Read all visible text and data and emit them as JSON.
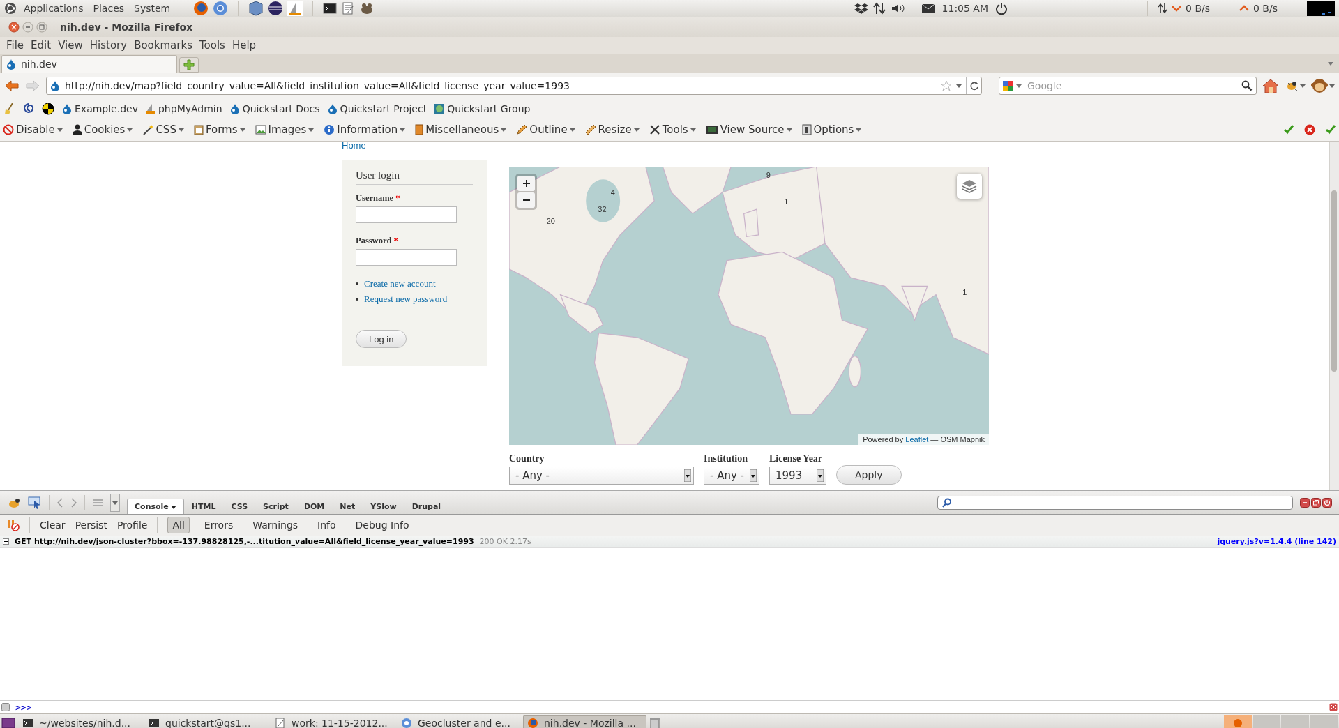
{
  "top_panel": {
    "menus": [
      "Applications",
      "Places",
      "System"
    ],
    "clock": "11:05 AM",
    "net_down": "0 B/s",
    "net_up": "0 B/s"
  },
  "window": {
    "title": "nih.dev - Mozilla Firefox"
  },
  "menu_bar": [
    "File",
    "Edit",
    "View",
    "History",
    "Bookmarks",
    "Tools",
    "Help"
  ],
  "tabs": [
    {
      "label": "nih.dev",
      "selected": true
    }
  ],
  "nav_bar": {
    "url": "http://nih.dev/map?field_country_value=All&field_institution_value=All&field_license_year_value=1993",
    "search_placeholder": "Google"
  },
  "bookmarks": [
    "Example.dev",
    "phpMyAdmin",
    "Quickstart Docs",
    "Quickstart Project",
    "Quickstart Group"
  ],
  "dev_toolbar": [
    "Disable",
    "Cookies",
    "CSS",
    "Forms",
    "Images",
    "Information",
    "Miscellaneous",
    "Outline",
    "Resize",
    "Tools",
    "View Source",
    "Options"
  ],
  "page": {
    "breadcrumb": "Home",
    "login": {
      "title": "User login",
      "fields": [
        {
          "label": "Username",
          "required_mark": "*"
        },
        {
          "label": "Password",
          "required_mark": "*"
        }
      ],
      "links": [
        "Create new account",
        "Request new password"
      ],
      "button": "Log in"
    },
    "map": {
      "clusters": [
        {
          "count": "9"
        },
        {
          "count": "4"
        },
        {
          "count": "32"
        },
        {
          "count": "20"
        },
        {
          "count": "1"
        },
        {
          "count": "1"
        }
      ],
      "attribution_prefix": "Powered by",
      "attribution_link": "Leaflet",
      "attribution_suffix": "— OSM Mapnik"
    },
    "filters": [
      {
        "label": "Country",
        "value": "- Any -"
      },
      {
        "label": "Institution",
        "value": "- Any -"
      },
      {
        "label": "License Year",
        "value": "1993"
      }
    ],
    "apply": "Apply"
  },
  "firebug": {
    "panels": [
      {
        "label": "Console",
        "selected": true
      },
      {
        "label": "HTML",
        "selected": false
      },
      {
        "label": "CSS",
        "selected": false
      },
      {
        "label": "Script",
        "selected": false
      },
      {
        "label": "DOM",
        "selected": false
      },
      {
        "label": "Net",
        "selected": false
      },
      {
        "label": "YSlow",
        "selected": false
      },
      {
        "label": "Drupal",
        "selected": false
      }
    ],
    "console_buttons": [
      "Clear",
      "Persist",
      "Profile"
    ],
    "filters": [
      {
        "label": "All",
        "selected": true
      },
      {
        "label": "Errors",
        "selected": false
      },
      {
        "label": "Warnings",
        "selected": false
      },
      {
        "label": "Info",
        "selected": false
      },
      {
        "label": "Debug Info",
        "selected": false
      }
    ],
    "log": [
      {
        "request": "GET http://nih.dev/json-cluster?bbox=-137.98828125,-...titution_value=All&field_license_year_value=1993",
        "status": "200 OK 2.17s",
        "source": "jquery.js?v=1.4.4 (line 142)"
      }
    ],
    "prompt": ">>>"
  },
  "taskbar": [
    {
      "label": "~/websites/nih.d...",
      "selected": false
    },
    {
      "label": "quickstart@qs1...",
      "selected": false
    },
    {
      "label": "work: 11-15-2012...",
      "selected": false
    },
    {
      "label": "Geocluster and e...",
      "selected": false
    },
    {
      "label": "nih.dev - Mozilla ...",
      "selected": true
    }
  ]
}
